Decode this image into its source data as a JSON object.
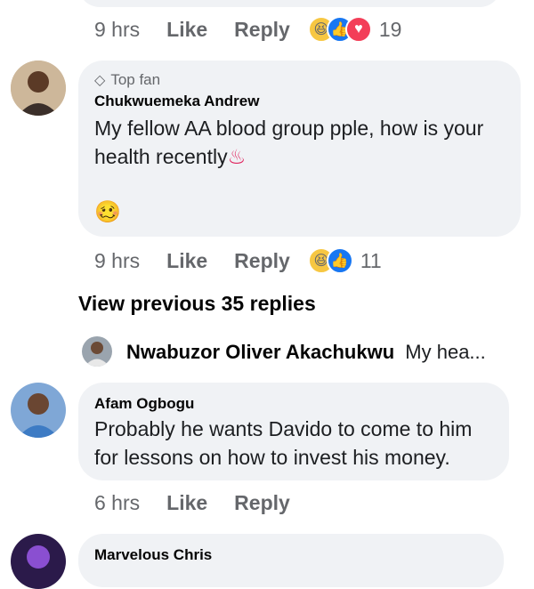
{
  "comment_top": {
    "time": "9 hrs",
    "like": "Like",
    "reply": "Reply",
    "reaction_count": "19"
  },
  "comment1": {
    "badge": "Top fan",
    "author": "Chukwuemeka Andrew",
    "text": "My fellow AA blood group pple, how is your health recently",
    "inline_emoji": "♨",
    "sticker_emoji": "🥴",
    "time": "9 hrs",
    "like": "Like",
    "reply": "Reply",
    "reaction_count": "11"
  },
  "view_previous": "View previous 35 replies",
  "collapsed_reply": {
    "author": "Nwabuzor Oliver Akachukwu",
    "snippet": "My hea..."
  },
  "comment2": {
    "author": "Afam Ogbogu",
    "text": "Probably he wants Davido to come to him for lessons on how to invest his money.",
    "time": "6 hrs",
    "like": "Like",
    "reply": "Reply"
  },
  "comment3": {
    "author": "Marvelous Chris"
  },
  "colors": {
    "bubble": "#f0f2f5",
    "meta_text": "#65676b",
    "like_blue": "#1877f2",
    "love_red": "#f33e58",
    "haha_yellow": "#f7c742"
  }
}
